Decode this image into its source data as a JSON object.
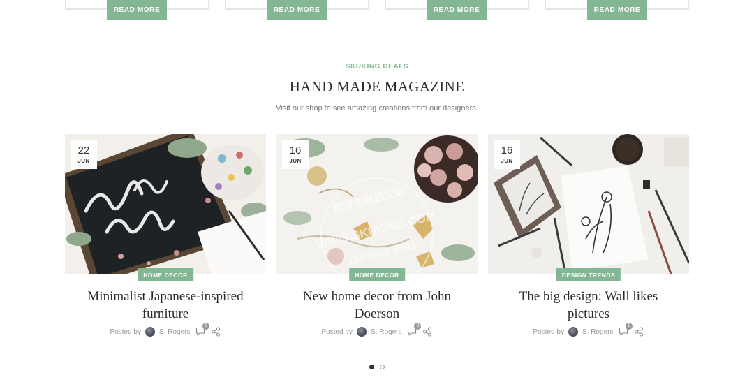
{
  "top_cards": [
    {
      "button_label": "READ MORE"
    },
    {
      "button_label": "READ MORE"
    },
    {
      "button_label": "READ MORE"
    },
    {
      "button_label": "READ MORE"
    }
  ],
  "section": {
    "eyebrow": "SKUKING DEALS",
    "title": "HAND MADE MAGAZINE",
    "subtitle": "Visit our shop to see amazing creations from our designers."
  },
  "posts": [
    {
      "day": "22",
      "month": "JUN",
      "category": "HOME DECOR",
      "title_line1": "Minimalist Japanese-inspired",
      "title_line2": "furniture",
      "posted_by": "Posted by",
      "author": "S. Rogers",
      "comments": "0",
      "image_icon": "thank-you-chalkboard-image"
    },
    {
      "day": "16",
      "month": "JUN",
      "category": "HOME DECOR",
      "title_line1": "New home decor from John",
      "title_line2": "Doerson",
      "posted_by": "Posted by",
      "author": "S. Rogers",
      "comments": "0",
      "image_icon": "christmas-ornaments-image"
    },
    {
      "day": "16",
      "month": "JUN",
      "category": "DESIGN TRENDS",
      "title_line1": "The big design: Wall likes",
      "title_line2": "pictures",
      "posted_by": "Posted by",
      "author": "S. Rogers",
      "comments": "0",
      "image_icon": "botanical-drawing-image"
    }
  ],
  "watermark": {
    "line1": "跨境电商独立站",
    "line2": "WWW.SKUKING.COM",
    "line3": "186 9830 8801"
  },
  "pagination": {
    "total": 2,
    "active": 1
  },
  "colors": {
    "accent": "#83b692",
    "text": "#2b2b2b",
    "muted": "#999999"
  }
}
